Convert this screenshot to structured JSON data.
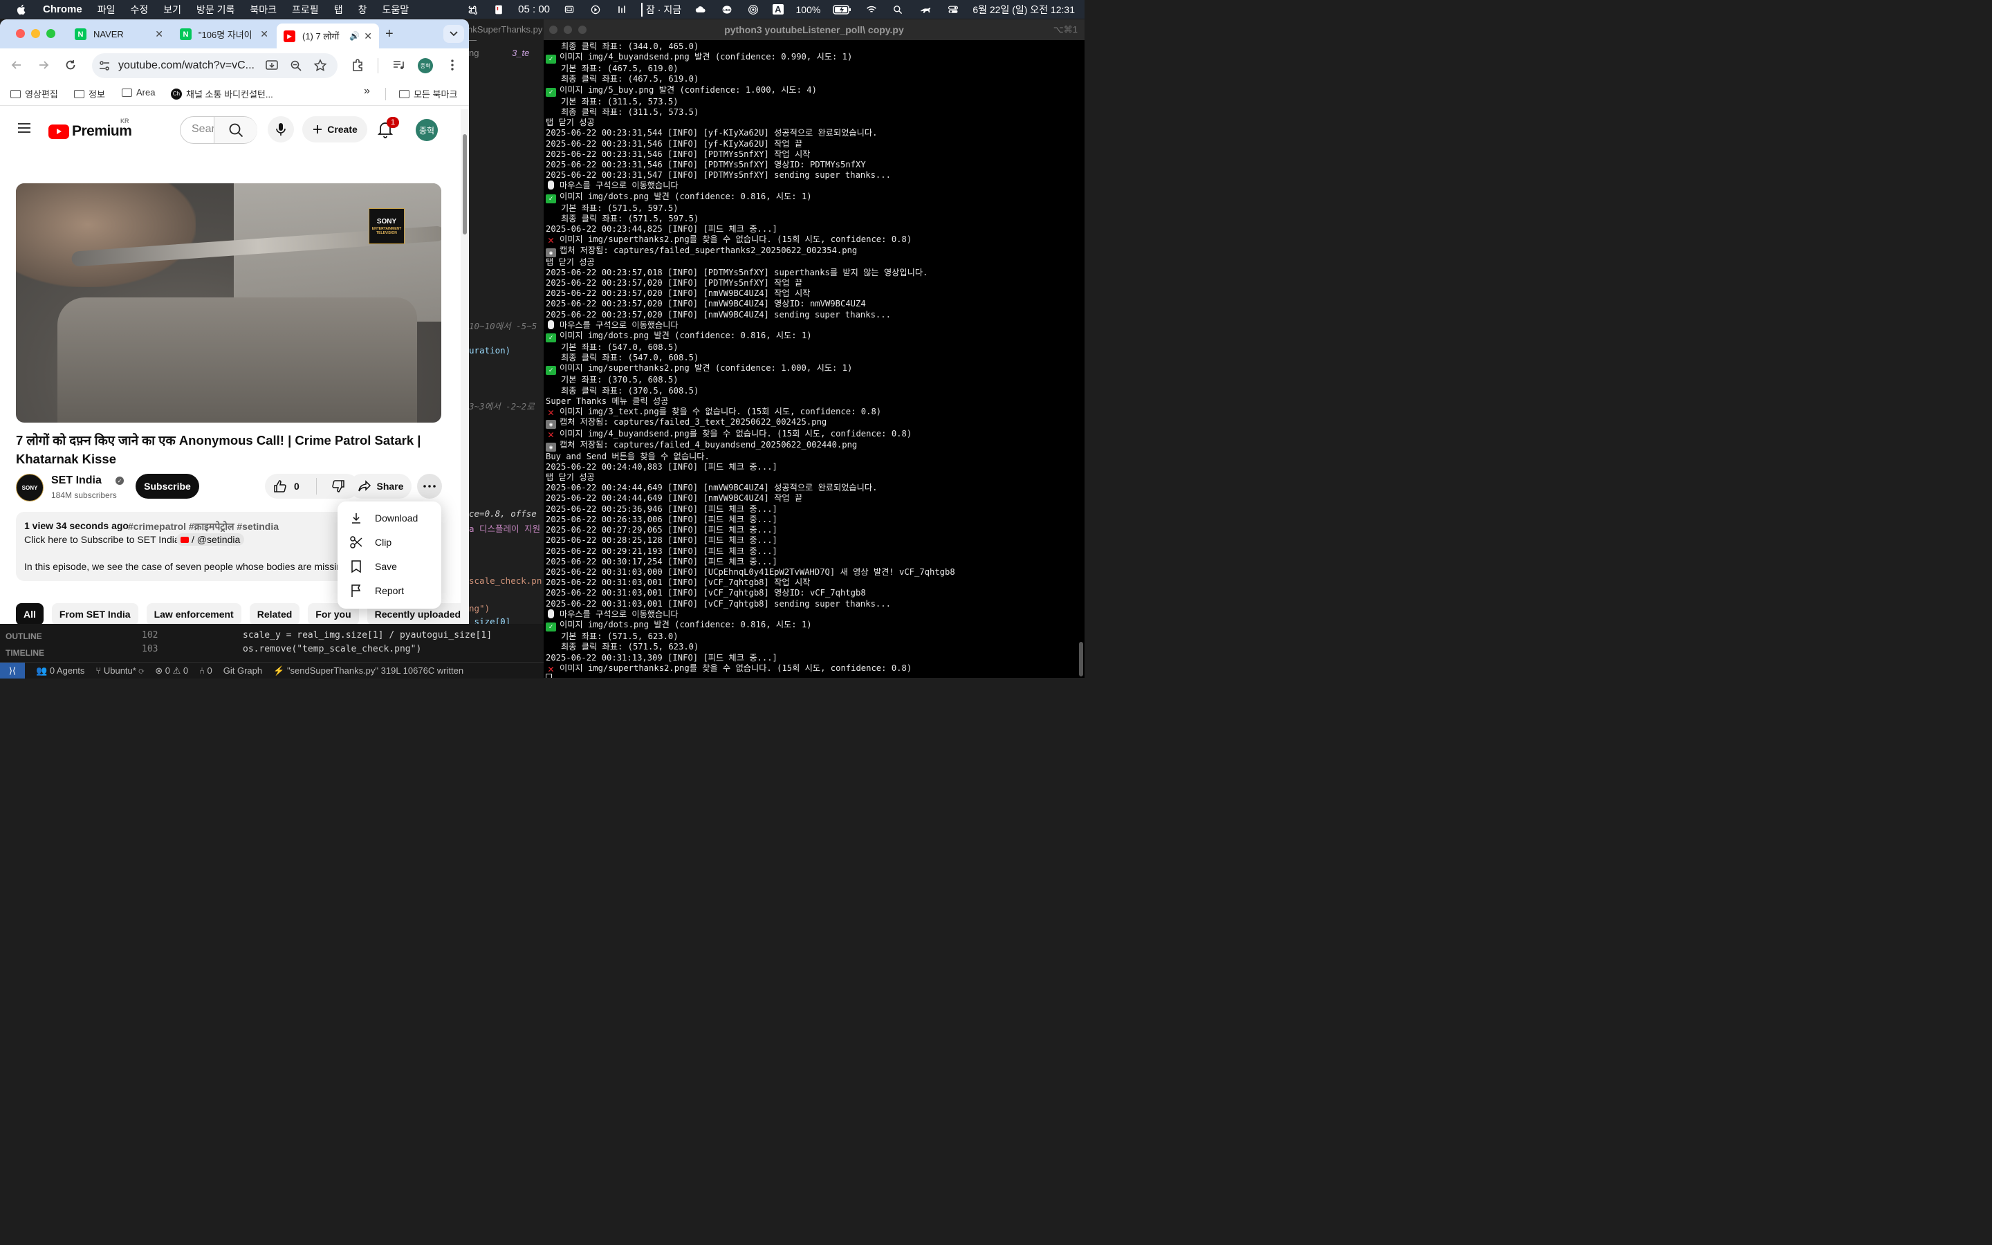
{
  "menubar": {
    "app": "Chrome",
    "items": [
      "파일",
      "수정",
      "보기",
      "방문 기록",
      "북마크",
      "프로필",
      "탭",
      "창",
      "도움말"
    ],
    "time_box": "05 : 00",
    "status_text": "잠 · 지금",
    "input_source": "A",
    "battery": "100%",
    "datetime": "6월 22일 (일) 오전 12:31"
  },
  "chrome": {
    "tabs": [
      {
        "title": "NAVER",
        "fav_color": "#03c75a",
        "fav_letter": "N"
      },
      {
        "title": "\"106명 자녀이",
        "fav_color": "#03c75a",
        "fav_letter": "N"
      },
      {
        "title": "(1) 7 लोगों",
        "fav_color": "#ff0000",
        "fav_letter": "▶"
      }
    ],
    "url": "youtube.com/watch?v=vC...",
    "profile_label": "종혁",
    "bookmarks": [
      {
        "label": "영상편집"
      },
      {
        "label": "정보"
      },
      {
        "label": "Area"
      },
      {
        "label": "채널 소통 바디컨설턴..."
      }
    ],
    "overflow": "»",
    "all_bookmarks": "모든 북마크"
  },
  "youtube": {
    "brand": "Premium",
    "region": "KR",
    "search_placeholder": "Search",
    "create_label": "Create",
    "notif_count": "1",
    "avatar_label": "종혁",
    "sony_top": "SONY",
    "sony_sub1": "ENTERTAINMENT",
    "sony_sub2": "TELEVISION",
    "video_title": "7 लोगों को दफ़्न किए जाने का एक Anonymous Call! | Crime Patrol Satark | Khatarnak Kisse",
    "channel_name": "SET India",
    "subscribers": "184M subscribers",
    "subscribe_label": "Subscribe",
    "likes": "0",
    "share_label": "Share",
    "desc_meta": "1 view  34 seconds ago",
    "desc_tags": "#crimepatrol #क्राइमपेट्रोल #setindia",
    "desc_line2": "Click here to Subscribe to SET India:",
    "desc_handle": "/ @setindia",
    "desc_line3": "In this episode, we see the case of seven people whose bodies are missing.",
    "chips": [
      "All",
      "From SET India",
      "Law enforcement",
      "Related",
      "For you",
      "Recently uploaded"
    ],
    "menu": [
      "Download",
      "Clip",
      "Save",
      "Report"
    ]
  },
  "editor": {
    "tab_fragments": [
      {
        "text": "nkSuperThanks.py —",
        "color": "#8a8a8a"
      },
      {
        "text": "ng",
        "color": "#8a8a8a"
      },
      {
        "text": "3_te",
        "color": "#c9a0dc"
      }
    ],
    "snippets": [
      {
        "text": "10~10에서 -5~5",
        "color": "#7a7a7a"
      },
      {
        "text": "uration)",
        "color": "#9cdcfe"
      },
      {
        "text": "3~3에서 -2~2로",
        "color": "#7a7a7a"
      },
      {
        "text": "ce=0.8, offse",
        "color": "#d4d4d4"
      },
      {
        "text": "a 디스플레이 지원",
        "color": "#c586c0"
      },
      {
        "text": "scale_check.pn",
        "color": "#ce9178"
      },
      {
        "text": "ng\")",
        "color": "#ce9178"
      },
      {
        "text": "_size[0]",
        "color": "#9cdcfe"
      }
    ],
    "outline": "OUTLINE",
    "timeline": "TIMELINE",
    "lines": [
      {
        "num": "102",
        "code": "scale_y = real_img.size[1] / pyautogui_size[1]"
      },
      {
        "num": "103",
        "code": "os.remove(\"temp_scale_check.png\")"
      }
    ],
    "status": {
      "agents": "0 Agents",
      "ubuntu": "Ubuntu*",
      "problems": "0 ⚠ 0",
      "ports": "0",
      "git": "Git Graph",
      "written": "\"sendSuperThanks.py\" 319L 10676C written"
    }
  },
  "terminal": {
    "title": "python3 youtubeListener_poll\\ copy.py",
    "shortcut": "⌥⌘1",
    "lines": [
      {
        "icon": "",
        "text": "   최종 클릭 좌표: (344.0, 465.0)"
      },
      {
        "icon": "check",
        "text": "이미지 img/4_buyandsend.png 발견 (confidence: 0.990, 시도: 1)"
      },
      {
        "icon": "",
        "text": "   기본 좌표: (467.5, 619.0)"
      },
      {
        "icon": "",
        "text": "   최종 클릭 좌표: (467.5, 619.0)"
      },
      {
        "icon": "check",
        "text": "이미지 img/5_buy.png 발견 (confidence: 1.000, 시도: 4)"
      },
      {
        "icon": "",
        "text": "   기본 좌표: (311.5, 573.5)"
      },
      {
        "icon": "",
        "text": "   최종 클릭 좌표: (311.5, 573.5)"
      },
      {
        "icon": "",
        "text": "탭 닫기 성공"
      },
      {
        "icon": "",
        "text": "2025-06-22 00:23:31,544 [INFO] [yf-KIyXa62U] 성공적으로 완료되었습니다."
      },
      {
        "icon": "",
        "text": "2025-06-22 00:23:31,546 [INFO] [yf-KIyXa62U] 작업 끝"
      },
      {
        "icon": "",
        "text": "2025-06-22 00:23:31,546 [INFO] [PDTMYs5nfXY] 작업 시작"
      },
      {
        "icon": "",
        "text": "2025-06-22 00:23:31,546 [INFO] [PDTMYs5nfXY] 영상ID: PDTMYs5nfXY"
      },
      {
        "icon": "",
        "text": "2025-06-22 00:23:31,547 [INFO] [PDTMYs5nfXY] sending super thanks..."
      },
      {
        "icon": "mouse",
        "text": "마우스를 구석으로 이동했습니다"
      },
      {
        "icon": "check",
        "text": "이미지 img/dots.png 발견 (confidence: 0.816, 시도: 1)"
      },
      {
        "icon": "",
        "text": "   기본 좌표: (571.5, 597.5)"
      },
      {
        "icon": "",
        "text": "   최종 클릭 좌표: (571.5, 597.5)"
      },
      {
        "icon": "",
        "text": "2025-06-22 00:23:44,825 [INFO] [피드 체크 중...]"
      },
      {
        "icon": "cross",
        "text": "이미지 img/superthanks2.png를 찾을 수 없습니다. (15회 시도, confidence: 0.8)"
      },
      {
        "icon": "cam",
        "text": "캡처 저장됨: captures/failed_superthanks2_20250622_002354.png"
      },
      {
        "icon": "",
        "text": "탭 닫기 성공"
      },
      {
        "icon": "",
        "text": "2025-06-22 00:23:57,018 [INFO] [PDTMYs5nfXY] superthanks를 받지 않는 영상입니다."
      },
      {
        "icon": "",
        "text": "2025-06-22 00:23:57,020 [INFO] [PDTMYs5nfXY] 작업 끝"
      },
      {
        "icon": "",
        "text": "2025-06-22 00:23:57,020 [INFO] [nmVW9BC4UZ4] 작업 시작"
      },
      {
        "icon": "",
        "text": "2025-06-22 00:23:57,020 [INFO] [nmVW9BC4UZ4] 영상ID: nmVW9BC4UZ4"
      },
      {
        "icon": "",
        "text": "2025-06-22 00:23:57,020 [INFO] [nmVW9BC4UZ4] sending super thanks..."
      },
      {
        "icon": "mouse",
        "text": "마우스를 구석으로 이동했습니다"
      },
      {
        "icon": "check",
        "text": "이미지 img/dots.png 발견 (confidence: 0.816, 시도: 1)"
      },
      {
        "icon": "",
        "text": "   기본 좌표: (547.0, 608.5)"
      },
      {
        "icon": "",
        "text": "   최종 클릭 좌표: (547.0, 608.5)"
      },
      {
        "icon": "check",
        "text": "이미지 img/superthanks2.png 발견 (confidence: 1.000, 시도: 1)"
      },
      {
        "icon": "",
        "text": "   기본 좌표: (370.5, 608.5)"
      },
      {
        "icon": "",
        "text": "   최종 클릭 좌표: (370.5, 608.5)"
      },
      {
        "icon": "",
        "text": "Super Thanks 메뉴 클릭 성공"
      },
      {
        "icon": "cross",
        "text": "이미지 img/3_text.png를 찾을 수 없습니다. (15회 시도, confidence: 0.8)"
      },
      {
        "icon": "cam",
        "text": "캡처 저장됨: captures/failed_3_text_20250622_002425.png"
      },
      {
        "icon": "cross",
        "text": "이미지 img/4_buyandsend.png를 찾을 수 없습니다. (15회 시도, confidence: 0.8)"
      },
      {
        "icon": "cam",
        "text": "캡처 저장됨: captures/failed_4_buyandsend_20250622_002440.png"
      },
      {
        "icon": "",
        "text": "Buy and Send 버튼을 찾을 수 없습니다."
      },
      {
        "icon": "",
        "text": "2025-06-22 00:24:40,883 [INFO] [피드 체크 중...]"
      },
      {
        "icon": "",
        "text": "탭 닫기 성공"
      },
      {
        "icon": "",
        "text": "2025-06-22 00:24:44,649 [INFO] [nmVW9BC4UZ4] 성공적으로 완료되었습니다."
      },
      {
        "icon": "",
        "text": "2025-06-22 00:24:44,649 [INFO] [nmVW9BC4UZ4] 작업 끝"
      },
      {
        "icon": "",
        "text": "2025-06-22 00:25:36,946 [INFO] [피드 체크 중...]"
      },
      {
        "icon": "",
        "text": "2025-06-22 00:26:33,006 [INFO] [피드 체크 중...]"
      },
      {
        "icon": "",
        "text": "2025-06-22 00:27:29,065 [INFO] [피드 체크 중...]"
      },
      {
        "icon": "",
        "text": "2025-06-22 00:28:25,128 [INFO] [피드 체크 중...]"
      },
      {
        "icon": "",
        "text": "2025-06-22 00:29:21,193 [INFO] [피드 체크 중...]"
      },
      {
        "icon": "",
        "text": "2025-06-22 00:30:17,254 [INFO] [피드 체크 중...]"
      },
      {
        "icon": "",
        "text": "2025-06-22 00:31:03,000 [INFO] [UCpEhnqL0y41EpW2TvWAHD7Q] 새 영상 발견! vCF_7qhtgb8"
      },
      {
        "icon": "",
        "text": "2025-06-22 00:31:03,001 [INFO] [vCF_7qhtgb8] 작업 시작"
      },
      {
        "icon": "",
        "text": "2025-06-22 00:31:03,001 [INFO] [vCF_7qhtgb8] 영상ID: vCF_7qhtgb8"
      },
      {
        "icon": "",
        "text": "2025-06-22 00:31:03,001 [INFO] [vCF_7qhtgb8] sending super thanks..."
      },
      {
        "icon": "mouse",
        "text": "마우스를 구석으로 이동했습니다"
      },
      {
        "icon": "check",
        "text": "이미지 img/dots.png 발견 (confidence: 0.816, 시도: 1)"
      },
      {
        "icon": "",
        "text": "   기본 좌표: (571.5, 623.0)"
      },
      {
        "icon": "",
        "text": "   최종 클릭 좌표: (571.5, 623.0)"
      },
      {
        "icon": "",
        "text": "2025-06-22 00:31:13,309 [INFO] [피드 체크 중...]"
      },
      {
        "icon": "cross",
        "text": "이미지 img/superthanks2.png를 찾을 수 없습니다. (15회 시도, confidence: 0.8)"
      }
    ]
  }
}
